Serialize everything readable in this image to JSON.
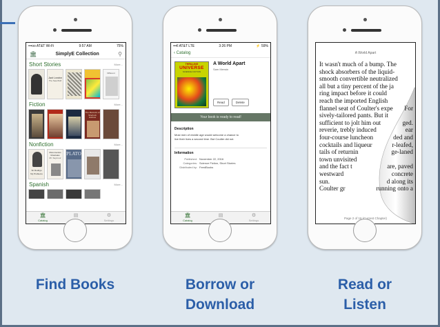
{
  "phone1": {
    "status": {
      "carrier": "•••oo AT&T Wi-Fi",
      "time": "9:57 AM",
      "battery": "75%"
    },
    "header": {
      "title": "SimplyE Collection"
    },
    "sections": [
      {
        "title": "Short Stories",
        "more": "More..."
      },
      {
        "title": "Fiction",
        "more": "More..."
      },
      {
        "title": "Nonfiction",
        "more": "More..."
      },
      {
        "title": "Spanish",
        "more": "More..."
      }
    ],
    "cover_texts": {
      "ss2": "Jack London",
      "ss2b": "The Sea-Wolf",
      "ss4": "Different",
      "nf2": "Monumentos Musicales",
      "nf2b": "Mr. Seymour",
      "nf3": "PLATO",
      "nf1b": "Sir Rodrigo",
      "nf1c": "My Problems",
      "f4": "The Memoirs of Sherlock Holmes"
    },
    "tabs": [
      {
        "label": "Catalog"
      },
      {
        "label": "My Books"
      },
      {
        "label": "Settings"
      }
    ]
  },
  "phone2": {
    "status": {
      "carrier": "•••ll AT&T  LTE",
      "time": "3:26 PM",
      "battery": "⚡ 59%"
    },
    "nav": {
      "back": "Catalog"
    },
    "book": {
      "title": "A World Apart",
      "author": "Sam Merwin",
      "cover_top": "THRILLING",
      "cover_title": "UNIVERSE",
      "cover_sub": "SCIENCE FICTION"
    },
    "buttons": {
      "read": "Read",
      "delete": "Delete"
    },
    "ready": "Your book is ready to read!",
    "description": {
      "title": "Description",
      "text1": "Most men of middle age would welcome a chance to",
      "text2": "live their lives a second time. But Coulter did not."
    },
    "information": {
      "title": "Information",
      "rows": [
        {
          "k": "Published:",
          "v": "November 22, 2016"
        },
        {
          "k": "Categories:",
          "v": "Science Fiction, Short Stories"
        },
        {
          "k": "Distributed by:",
          "v": "FeedBooks"
        }
      ]
    },
    "tabs": [
      {
        "label": "Catalog"
      },
      {
        "label": "My Books"
      },
      {
        "label": "Settings"
      }
    ]
  },
  "phone3": {
    "title": "A World Apart",
    "lines": [
      "It wasn't much of a bump. The",
      "shock absorbers of the liquid-",
      "smooth convertible neutralized",
      "all but a tiny percent of the ja",
      "ring impact before it could",
      "reach the imported English",
      "flannel seat of Coulter's expe",
      "sively-tailored pants. But it",
      "sufficient to jolt him out",
      "reverie, trebly induced",
      "four-course luncheon",
      "cocktails and liqueur",
      "tails of returnin",
      "town unvisited",
      "and the fact t",
      "westward",
      "sun.",
      "Coulter gr"
    ],
    "curl_lines": [
      "For",
      "ged.",
      "ear",
      "ded and",
      "r-leafed,",
      "ge-laned",
      "are, paved",
      "concrete",
      "d along its",
      "running onto a"
    ],
    "footer": "Page 2 of 16 (Current Chapter)"
  },
  "captions": [
    {
      "line1": "Find Books",
      "line2": ""
    },
    {
      "line1": "Borrow or",
      "line2": "Download"
    },
    {
      "line1": "Read or",
      "line2": "Listen"
    }
  ],
  "colors": {
    "caption": "#2b5ea8",
    "accent": "#2e6f2e",
    "ready_bar": "#667766"
  }
}
